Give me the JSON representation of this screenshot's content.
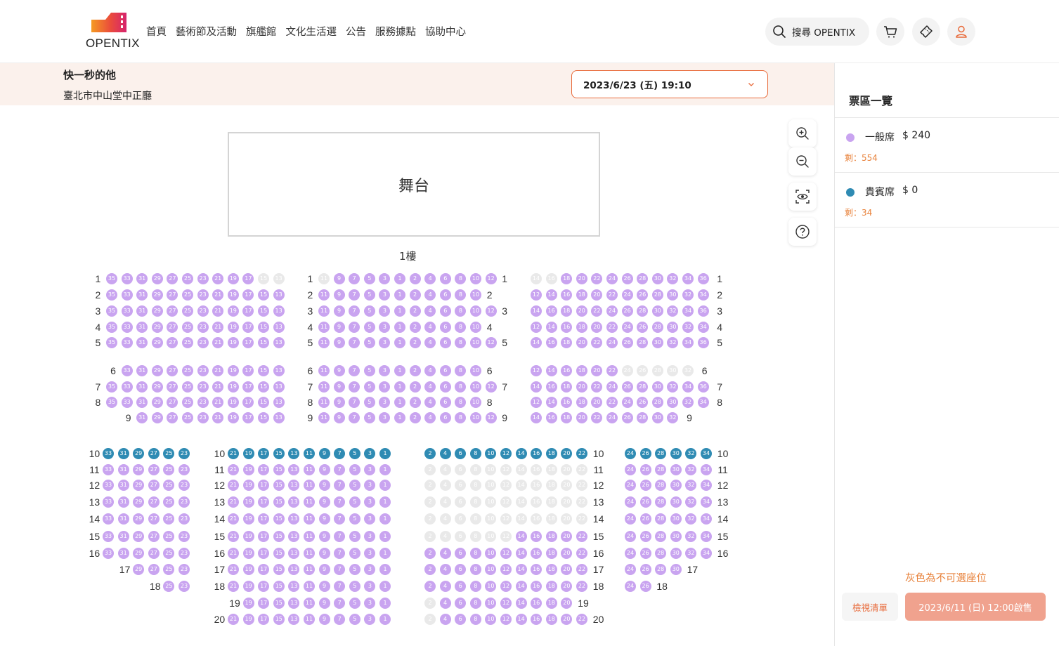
{
  "header": {
    "logo_text": "OPENTIX",
    "nav": [
      "首頁",
      "藝術節及活動",
      "旗艦館",
      "文化生活選",
      "公告",
      "服務據點",
      "協助中心"
    ],
    "search_label": "搜尋 OPENTIX"
  },
  "event": {
    "title": "快一秒的他",
    "venue": "臺北市中山堂中正廳",
    "date": "2023/6/23 (五) 19:10"
  },
  "seatmap": {
    "stage_label": "舞台",
    "floor_label": "1樓"
  },
  "panel": {
    "title": "票區一覽",
    "zones": [
      {
        "name": "一般席",
        "price": "$ 240",
        "remaining": "剩：554",
        "color": "#c9a4f0"
      },
      {
        "name": "貴賓席",
        "price": "$ 0",
        "remaining": "剩：34",
        "color": "#2f8bb3"
      }
    ],
    "note": "灰色為不可選座位",
    "list_button": "檢視清單",
    "sale_button": "2023/6/11 (日) 12:00啟售"
  },
  "colors": {
    "accent": "#e86a3a",
    "general": "#c9a4f0",
    "vip": "#2f8bb3",
    "unavailable": "#e9e9e9"
  },
  "rows": [
    {
      "label": "1",
      "blocks": {
        "A": [
          "g35",
          "g33",
          "g31",
          "g29",
          "g27",
          "g25",
          "g23",
          "g21",
          "g19",
          "g17",
          "x15",
          "x13"
        ],
        "B": [
          "x11",
          "g9",
          "g7",
          "g5",
          "g3",
          "g1",
          "g2",
          "g4",
          "g6",
          "g8",
          "g10",
          "g12"
        ],
        "C": [
          "x14",
          "x16",
          "g18",
          "g20",
          "g22",
          "g24",
          "g26",
          "g28",
          "g30",
          "g32",
          "g34",
          "g36"
        ]
      }
    },
    {
      "label": "2",
      "blocks": {
        "A": [
          "g35",
          "g33",
          "g31",
          "g29",
          "g27",
          "g25",
          "g23",
          "g21",
          "g19",
          "g17",
          "g15",
          "g13"
        ],
        "B": [
          "g11",
          "g9",
          "g7",
          "g5",
          "g3",
          "g1",
          "g2",
          "g4",
          "g6",
          "g8",
          "g10"
        ],
        "C": [
          "g12",
          "g14",
          "g16",
          "g18",
          "g20",
          "g22",
          "g24",
          "g26",
          "g28",
          "g30",
          "g32",
          "g34"
        ]
      }
    },
    {
      "label": "3",
      "blocks": {
        "A": [
          "g35",
          "g33",
          "g31",
          "g29",
          "g27",
          "g25",
          "g23",
          "g21",
          "g19",
          "g17",
          "g15",
          "g13"
        ],
        "B": [
          "g11",
          "g9",
          "g7",
          "g5",
          "g3",
          "g1",
          "g2",
          "g4",
          "g6",
          "g8",
          "g10",
          "g12"
        ],
        "C": [
          "g14",
          "g16",
          "g18",
          "g20",
          "g22",
          "g24",
          "g26",
          "g28",
          "g30",
          "g32",
          "g34",
          "g36"
        ]
      }
    },
    {
      "label": "4",
      "blocks": {
        "A": [
          "g35",
          "g33",
          "g31",
          "g29",
          "g27",
          "g25",
          "g23",
          "g21",
          "g19",
          "g17",
          "g15",
          "g13"
        ],
        "B": [
          "g11",
          "g9",
          "g7",
          "g5",
          "g3",
          "g1",
          "g2",
          "g4",
          "g6",
          "g8",
          "g10"
        ],
        "C": [
          "g12",
          "g14",
          "g16",
          "g18",
          "g20",
          "g22",
          "g24",
          "g26",
          "g28",
          "g30",
          "g32",
          "g34"
        ]
      }
    },
    {
      "label": "5",
      "blocks": {
        "A": [
          "g35",
          "g33",
          "g31",
          "g29",
          "g27",
          "g25",
          "g23",
          "g21",
          "g19",
          "g17",
          "g15",
          "g13"
        ],
        "B": [
          "g11",
          "g9",
          "g7",
          "g5",
          "g3",
          "g1",
          "g2",
          "g4",
          "g6",
          "g8",
          "g10",
          "g12"
        ],
        "C": [
          "g14",
          "g16",
          "g18",
          "g20",
          "g22",
          "g24",
          "g26",
          "g28",
          "g30",
          "g32",
          "g34",
          "g36"
        ]
      }
    },
    {
      "label": "6",
      "blocks": {
        "A": [
          "g33",
          "g31",
          "g29",
          "g27",
          "g25",
          "g23",
          "g21",
          "g19",
          "g17",
          "g15",
          "g13"
        ],
        "B": [
          "g11",
          "g9",
          "g7",
          "g5",
          "g3",
          "g1",
          "g2",
          "g4",
          "g6",
          "g8",
          "g10"
        ],
        "C": [
          "g12",
          "g14",
          "g16",
          "g18",
          "g20",
          "g22",
          "x24",
          "x26",
          "x28",
          "x30",
          "x32"
        ]
      }
    },
    {
      "label": "7",
      "blocks": {
        "A": [
          "g35",
          "g33",
          "g31",
          "g29",
          "g27",
          "g25",
          "g23",
          "g21",
          "g19",
          "g17",
          "g15",
          "g13"
        ],
        "B": [
          "g11",
          "g9",
          "g7",
          "g5",
          "g3",
          "g1",
          "g2",
          "g4",
          "g6",
          "g8",
          "g10",
          "g12"
        ],
        "C": [
          "g14",
          "g16",
          "g18",
          "g20",
          "g22",
          "g24",
          "g26",
          "g28",
          "g30",
          "g32",
          "g34",
          "g36"
        ]
      }
    },
    {
      "label": "8",
      "blocks": {
        "A": [
          "g35",
          "g33",
          "g31",
          "g29",
          "g27",
          "g25",
          "g23",
          "g21",
          "g19",
          "g17",
          "g15",
          "g13"
        ],
        "B": [
          "g11",
          "g9",
          "g7",
          "g5",
          "g3",
          "g1",
          "g2",
          "g4",
          "g6",
          "g8",
          "g10"
        ],
        "C": [
          "g12",
          "g14",
          "g16",
          "g18",
          "g20",
          "g22",
          "g24",
          "g26",
          "g28",
          "g30",
          "g32",
          "g34"
        ]
      }
    },
    {
      "label": "9",
      "blocks": {
        "A": [
          "g31",
          "g29",
          "g27",
          "g25",
          "g23",
          "g21",
          "g19",
          "g17",
          "g15",
          "g13"
        ],
        "B": [
          "g11",
          "g9",
          "g7",
          "g5",
          "g3",
          "g1",
          "g2",
          "g4",
          "g6",
          "g8",
          "g10",
          "g12"
        ],
        "C": [
          "g14",
          "g16",
          "g18",
          "g20",
          "g22",
          "g24",
          "g26",
          "g28",
          "g30",
          "g32"
        ]
      }
    },
    {
      "label": "10",
      "blocks": {
        "D": [
          "v33",
          "v31",
          "v29",
          "v27",
          "v25",
          "v23"
        ],
        "E": [
          "v21",
          "v19",
          "v17",
          "v15",
          "v13",
          "v11",
          "v9",
          "v7",
          "v5",
          "v3",
          "v1"
        ],
        "F": [
          "v2",
          "v4",
          "v6",
          "v8",
          "v10",
          "v12",
          "v14",
          "v16",
          "v18",
          "v20",
          "v22"
        ],
        "G": [
          "v24",
          "v26",
          "v28",
          "v30",
          "v32",
          "v34"
        ]
      }
    },
    {
      "label": "11",
      "blocks": {
        "D": [
          "g33",
          "g31",
          "g29",
          "g27",
          "g25",
          "g23"
        ],
        "E": [
          "g21",
          "g19",
          "g17",
          "g15",
          "g13",
          "g11",
          "g9",
          "g7",
          "g5",
          "g3",
          "g1"
        ],
        "F": [
          "x2",
          "x4",
          "x6",
          "x8",
          "x10",
          "x12",
          "x14",
          "x16",
          "x18",
          "x20",
          "x22"
        ],
        "G": [
          "g24",
          "g26",
          "g28",
          "g30",
          "g32",
          "g34"
        ]
      }
    },
    {
      "label": "12",
      "blocks": {
        "D": [
          "g33",
          "g31",
          "g29",
          "g27",
          "g25",
          "g23"
        ],
        "E": [
          "g21",
          "g19",
          "g17",
          "g15",
          "g13",
          "g11",
          "g9",
          "g7",
          "g5",
          "g3",
          "g1"
        ],
        "F": [
          "x2",
          "x4",
          "x6",
          "x8",
          "x10",
          "x12",
          "x14",
          "x16",
          "x18",
          "x20",
          "x22"
        ],
        "G": [
          "g24",
          "g26",
          "g28",
          "g30",
          "g32",
          "g34"
        ]
      }
    },
    {
      "label": "13",
      "blocks": {
        "D": [
          "g33",
          "g31",
          "g29",
          "g27",
          "g25",
          "g23"
        ],
        "E": [
          "g21",
          "g19",
          "g17",
          "g15",
          "g13",
          "g11",
          "g9",
          "g7",
          "g5",
          "g3",
          "g1"
        ],
        "F": [
          "x2",
          "x4",
          "x6",
          "x8",
          "x10",
          "x12",
          "x14",
          "x16",
          "x18",
          "x20",
          "x22"
        ],
        "G": [
          "g24",
          "g26",
          "g28",
          "g30",
          "g32",
          "g34"
        ]
      }
    },
    {
      "label": "14",
      "blocks": {
        "D": [
          "g33",
          "g31",
          "g29",
          "g27",
          "g25",
          "g23"
        ],
        "E": [
          "g21",
          "g19",
          "g17",
          "g15",
          "g13",
          "g11",
          "g9",
          "g7",
          "g5",
          "g3",
          "g1"
        ],
        "F": [
          "x2",
          "x4",
          "x6",
          "x8",
          "x10",
          "x12",
          "x14",
          "x16",
          "x18",
          "x20",
          "x22"
        ],
        "G": [
          "g24",
          "g26",
          "g28",
          "g30",
          "g32",
          "g34"
        ]
      }
    },
    {
      "label": "15",
      "blocks": {
        "D": [
          "g33",
          "g31",
          "g29",
          "g27",
          "g25",
          "g23"
        ],
        "E": [
          "g21",
          "g19",
          "g17",
          "g15",
          "g13",
          "g11",
          "g9",
          "g7",
          "g5",
          "g3",
          "g1"
        ],
        "F": [
          "x2",
          "x4",
          "x6",
          "x8",
          "x10",
          "x12",
          "g14",
          "g16",
          "g18",
          "g20",
          "g22"
        ],
        "G": [
          "g24",
          "g26",
          "g28",
          "g30",
          "g32",
          "g34"
        ]
      }
    },
    {
      "label": "16",
      "blocks": {
        "D": [
          "g33",
          "g31",
          "g29",
          "g27",
          "g25",
          "g23"
        ],
        "E": [
          "g21",
          "g19",
          "g17",
          "g15",
          "g13",
          "g11",
          "g9",
          "g7",
          "g5",
          "g3",
          "g1"
        ],
        "F": [
          "g2",
          "g4",
          "g6",
          "g8",
          "g10",
          "g12",
          "g14",
          "g16",
          "g18",
          "g20",
          "g22"
        ],
        "G": [
          "g24",
          "g26",
          "g28",
          "g30",
          "g32",
          "g34"
        ]
      }
    },
    {
      "label": "17",
      "blocks": {
        "D": [
          "g29",
          "g27",
          "g25",
          "g23"
        ],
        "E": [
          "g21",
          "g19",
          "g17",
          "g15",
          "g13",
          "g11",
          "g9",
          "g7",
          "g5",
          "g3",
          "g1"
        ],
        "F": [
          "g2",
          "g4",
          "g6",
          "g8",
          "g10",
          "g12",
          "g14",
          "g16",
          "g18",
          "g20",
          "g22"
        ],
        "G": [
          "g24",
          "g26",
          "g28",
          "g30"
        ]
      }
    },
    {
      "label": "18",
      "blocks": {
        "D": [
          "g25",
          "g23"
        ],
        "E": [
          "g21",
          "g19",
          "g17",
          "g15",
          "g13",
          "g11",
          "g9",
          "g7",
          "g5",
          "g3",
          "g1"
        ],
        "F": [
          "g2",
          "g4",
          "g6",
          "g8",
          "g10",
          "g12",
          "g14",
          "g16",
          "g18",
          "g20",
          "g22"
        ],
        "G": [
          "g24",
          "g26"
        ]
      }
    },
    {
      "label": "19",
      "blocks": {
        "E": [
          "g19",
          "g17",
          "g15",
          "g13",
          "g11",
          "g9",
          "g7",
          "g5",
          "g3",
          "g1"
        ],
        "F": [
          "x2",
          "g4",
          "g6",
          "g8",
          "g10",
          "g12",
          "g14",
          "g16",
          "g18",
          "g20"
        ]
      }
    },
    {
      "label": "20",
      "blocks": {
        "E": [
          "g21",
          "g19",
          "g17",
          "g15",
          "g13",
          "g11",
          "g9",
          "g7",
          "g5",
          "g3",
          "g1"
        ],
        "F": [
          "x2",
          "g4",
          "g6",
          "g8",
          "g10",
          "g12",
          "g14",
          "g16",
          "g18",
          "g20",
          "g22"
        ]
      }
    }
  ]
}
